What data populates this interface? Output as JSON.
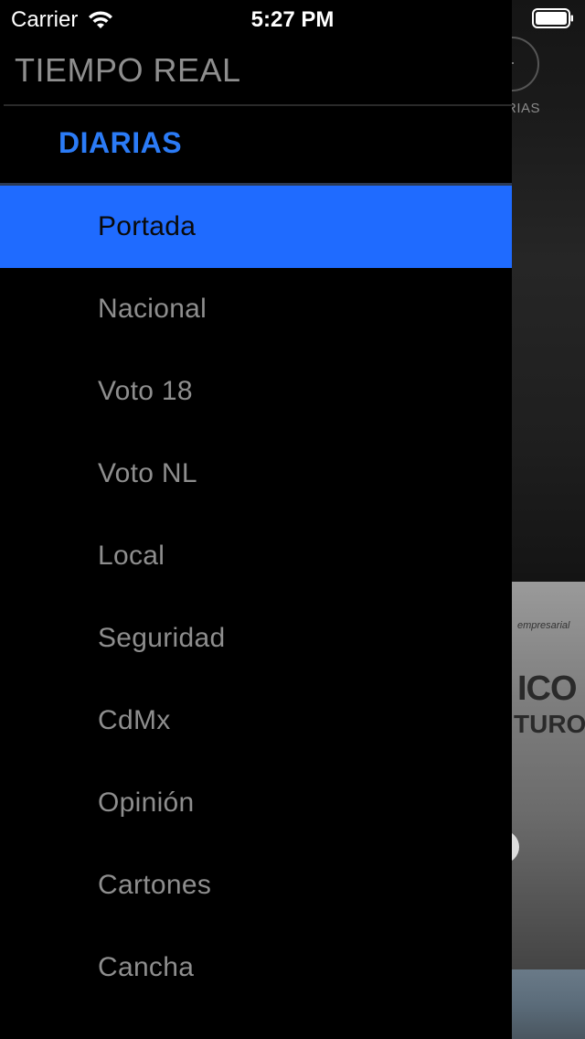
{
  "status_bar": {
    "carrier": "Carrier",
    "time": "5:27 PM"
  },
  "background": {
    "partial_label": "RIAS"
  },
  "drawer": {
    "header": "TIEMPO REAL",
    "section_title": "DIARIAS",
    "selected_index": 0,
    "items": [
      {
        "label": "Portada"
      },
      {
        "label": "Nacional"
      },
      {
        "label": "Voto 18"
      },
      {
        "label": "Voto NL"
      },
      {
        "label": "Local"
      },
      {
        "label": "Seguridad"
      },
      {
        "label": "CdMx"
      },
      {
        "label": "Opinión"
      },
      {
        "label": "Cartones"
      },
      {
        "label": "Cancha"
      }
    ]
  },
  "colors": {
    "accent": "#1f6bff",
    "section_title": "#2b7bf6",
    "item_text": "#8e8e8e",
    "drawer_background": "#000000"
  }
}
